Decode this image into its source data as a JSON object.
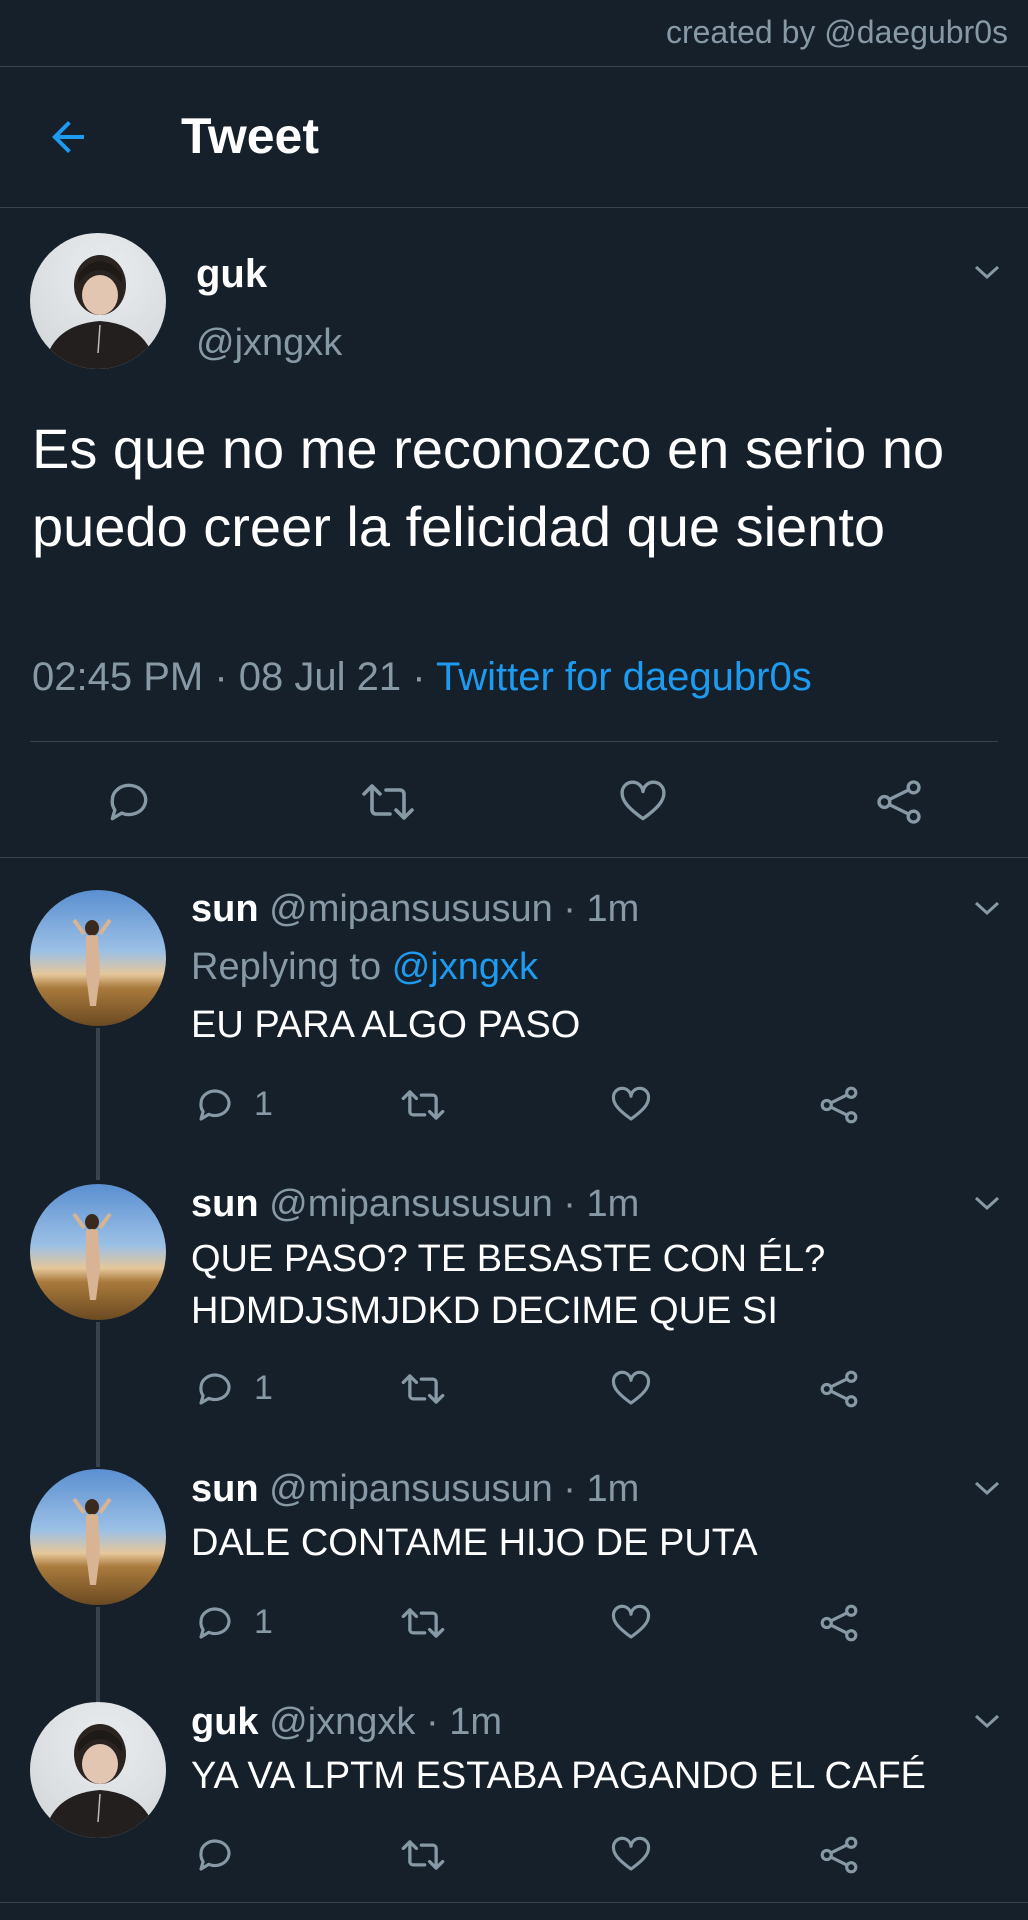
{
  "credit": "created by @daegubr0s",
  "header": {
    "title": "Tweet"
  },
  "main_tweet": {
    "name": "guk",
    "handle": "@jxngxk",
    "text": "Es que no me reconozco en serio no puedo creer la felicidad que siento",
    "time": "02:45 PM",
    "date": "08 Jul 21",
    "separator": "·",
    "source": "Twitter for daegubr0s"
  },
  "replies": [
    {
      "name": "sun",
      "handle": "@mipansususun",
      "time": "· 1m",
      "replying_label": "Replying to",
      "replying_to": "@jxngxk",
      "text": "EU PARA ALGO PASO",
      "reply_count": "1"
    },
    {
      "name": "sun",
      "handle": "@mipansususun",
      "time": "· 1m",
      "text_line1": "QUE PASO? TE BESASTE CON ÉL?",
      "text_line2": "HDMDJSMJDKD DECIME QUE SI",
      "reply_count": "1"
    },
    {
      "name": "sun",
      "handle": "@mipansususun",
      "time": "· 1m",
      "text": "DALE CONTAME HIJO DE PUTA",
      "reply_count": "1"
    },
    {
      "name": "guk",
      "handle": "@jxngxk",
      "time": "· 1m",
      "text": "YA VA LPTM ESTABA PAGANDO EL CAFÉ"
    }
  ],
  "colors": {
    "background": "#15202b",
    "accent": "#1d9bf0",
    "muted": "#8899a6",
    "divider": "#38444d"
  }
}
